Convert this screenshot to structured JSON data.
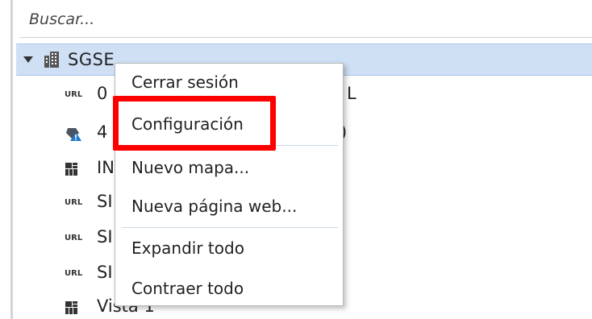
{
  "search": {
    "placeholder": "Buscar..."
  },
  "tree": {
    "root_label": "SGSE",
    "items": [
      {
        "icon": "url-icon",
        "label": "0",
        "tail": "L"
      },
      {
        "icon": "alert-marker-icon",
        "label": "4",
        "tail": ")"
      },
      {
        "icon": "grid-icon",
        "label": "IN",
        "tail": ""
      },
      {
        "icon": "url-icon",
        "label": "SI",
        "tail": ""
      },
      {
        "icon": "url-icon",
        "label": "SI",
        "tail": ""
      },
      {
        "icon": "url-icon",
        "label": "SI",
        "tail": ""
      },
      {
        "icon": "grid-icon",
        "label": "Vista 1",
        "tail": ""
      }
    ]
  },
  "context_menu": {
    "items": [
      {
        "label": "Cerrar sesión"
      },
      {
        "label": "Configuración"
      },
      {
        "label": "Nuevo mapa..."
      },
      {
        "label": "Nueva página web..."
      },
      {
        "label": "Expandir todo"
      },
      {
        "label": "Contraer todo"
      }
    ]
  },
  "colors": {
    "root_row_bg": "#cfe0f5",
    "highlight": "#ff0000"
  },
  "icons": {
    "url": "URL"
  }
}
